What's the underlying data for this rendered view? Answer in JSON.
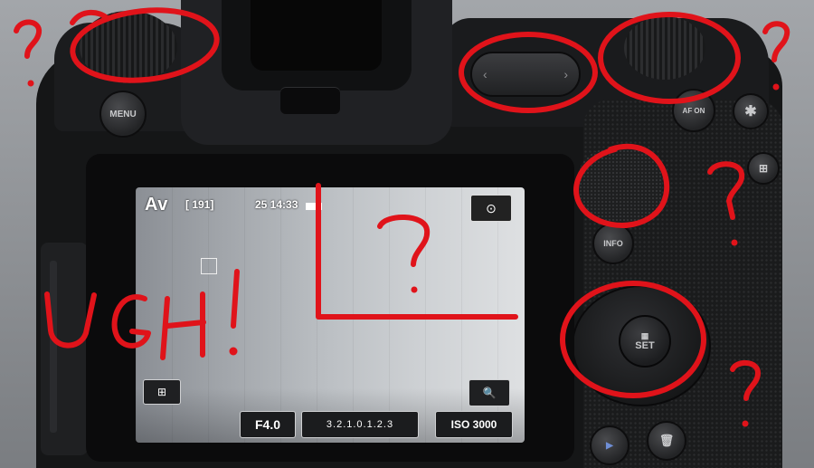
{
  "camera_labels": {
    "menu_button": "MENU",
    "af_button": "AF ON",
    "info_button": "INFO",
    "set_button": "SET",
    "set_glyph": "▦",
    "star_button": "✱",
    "zoom_button": "⊞",
    "play_button": "▶",
    "trash_button": "🗑",
    "mfn_left": "‹",
    "mfn_right": "›"
  },
  "screen": {
    "shooting_mode": "Av",
    "shots_remaining": "[ 191]",
    "clock": "25 14:33",
    "top_right_icon": "⊙",
    "quick_menu_icon": "⊞",
    "magnify_icon": "🔍",
    "aperture": "F4.0",
    "exposure_scale": "3.2.1.0.1.2.3",
    "iso": "ISO 3000"
  },
  "annotations": {
    "exclaim": "UGH!",
    "question_mark": "?",
    "color": "#e0131a"
  }
}
